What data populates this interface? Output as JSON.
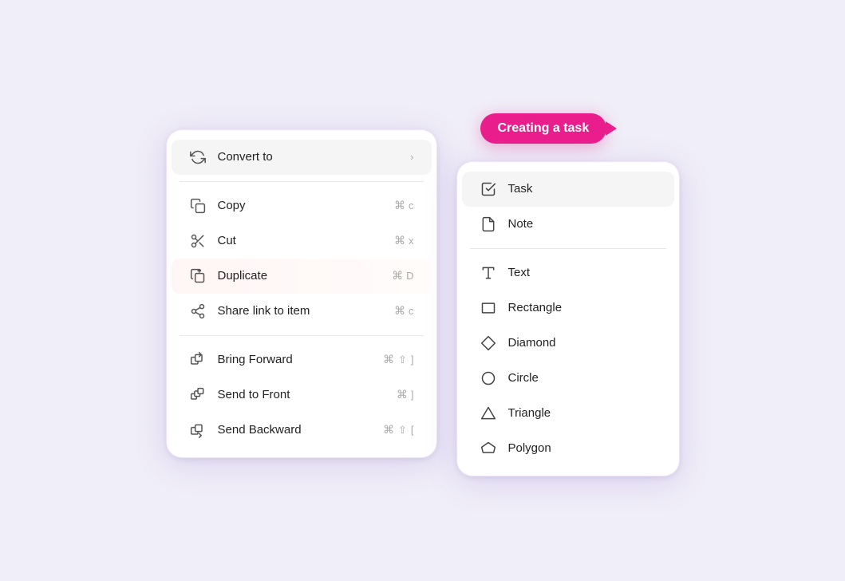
{
  "leftMenu": {
    "items": [
      {
        "id": "convert-to",
        "label": "Convert to",
        "icon": "convert-icon",
        "shortcut": "",
        "hasArrow": true,
        "highlighted": false,
        "dividerAfter": false
      },
      {
        "id": "copy",
        "label": "Copy",
        "icon": "copy-icon",
        "shortcutCmd": "⌘",
        "shortcutKey": "c",
        "hasArrow": false,
        "highlighted": false,
        "dividerAfter": false
      },
      {
        "id": "cut",
        "label": "Cut",
        "icon": "cut-icon",
        "shortcutCmd": "⌘",
        "shortcutKey": "x",
        "hasArrow": false,
        "highlighted": false,
        "dividerAfter": false
      },
      {
        "id": "duplicate",
        "label": "Duplicate",
        "icon": "duplicate-icon",
        "shortcutCmd": "⌘",
        "shortcutKey": "D",
        "hasArrow": false,
        "highlighted": true,
        "dividerAfter": false
      },
      {
        "id": "share-link",
        "label": "Share link to item",
        "icon": "share-icon",
        "shortcutCmd": "⌘",
        "shortcutKey": "c",
        "hasArrow": false,
        "highlighted": false,
        "dividerAfter": true
      },
      {
        "id": "bring-forward",
        "label": "Bring Forward",
        "icon": "bring-forward-icon",
        "shortcutCmd": "⌘",
        "shortcutShift": "⇧",
        "shortcutKey": "]",
        "hasArrow": false,
        "highlighted": false,
        "dividerAfter": false
      },
      {
        "id": "send-to-front",
        "label": "Send to Front",
        "icon": "send-front-icon",
        "shortcutCmd": "⌘",
        "shortcutKey": "]",
        "hasArrow": false,
        "highlighted": false,
        "dividerAfter": false
      },
      {
        "id": "send-backward",
        "label": "Send Backward",
        "icon": "send-backward-icon",
        "shortcutCmd": "⌘",
        "shortcutShift": "⇧",
        "shortcutKey": "[",
        "hasArrow": false,
        "highlighted": false,
        "dividerAfter": false
      }
    ]
  },
  "rightPanel": {
    "tooltip": "Creating a task",
    "items": [
      {
        "id": "task",
        "label": "Task",
        "icon": "task-icon",
        "active": true
      },
      {
        "id": "note",
        "label": "Note",
        "icon": "note-icon",
        "active": false
      },
      {
        "id": "text",
        "label": "Text",
        "icon": "text-icon",
        "active": false
      },
      {
        "id": "rectangle",
        "label": "Rectangle",
        "icon": "rectangle-icon",
        "active": false
      },
      {
        "id": "diamond",
        "label": "Diamond",
        "icon": "diamond-icon",
        "active": false
      },
      {
        "id": "circle",
        "label": "Circle",
        "icon": "circle-icon",
        "active": false
      },
      {
        "id": "triangle",
        "label": "Triangle",
        "icon": "triangle-icon",
        "active": false
      },
      {
        "id": "polygon",
        "label": "Polygon",
        "icon": "polygon-icon",
        "active": false
      }
    ]
  }
}
